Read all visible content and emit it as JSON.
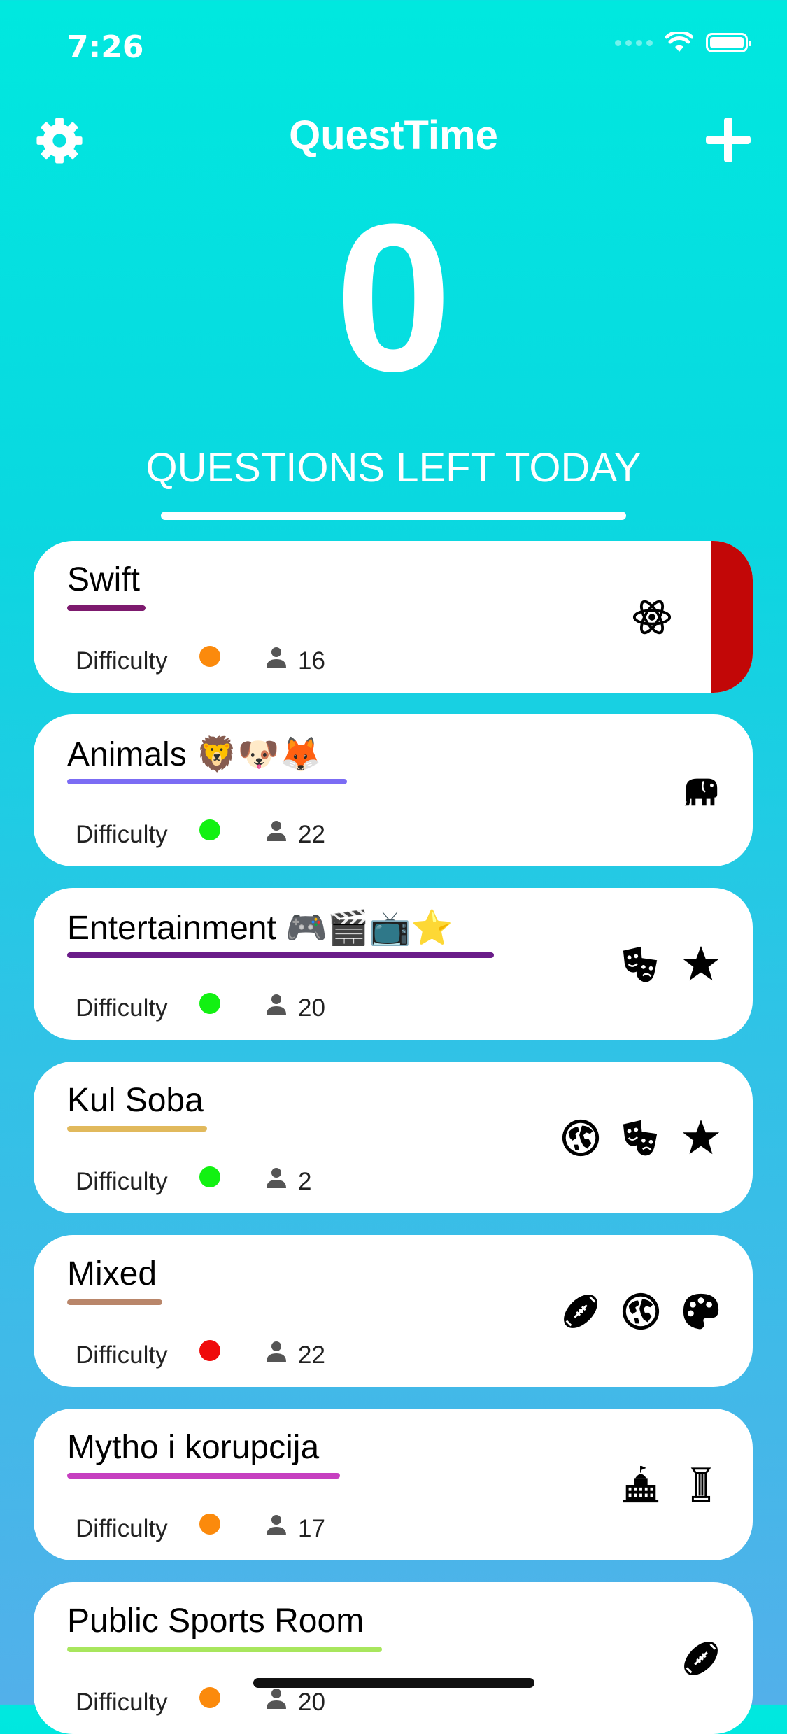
{
  "status_bar": {
    "time": "7:26"
  },
  "header": {
    "title": "QuestTime",
    "settings_icon": "gear-icon",
    "add_icon": "plus-icon"
  },
  "hero": {
    "count": "0",
    "label": "QUESTIONS LEFT TODAY"
  },
  "colors": {
    "background_top": "#00e8df",
    "background_bottom": "#52b0ea",
    "easy": "#12f112",
    "medium": "#fb8a0c",
    "hard": "#ef0b0b",
    "selected_tab": "#c20707"
  },
  "rooms": [
    {
      "name": "Swift",
      "difficulty_label": "Difficulty",
      "difficulty": "medium",
      "players": "16",
      "underline_color": "#7d1a6e",
      "icons": [
        "atom-icon"
      ],
      "selected": true
    },
    {
      "name": "Animals 🦁🐶🦊",
      "difficulty_label": "Difficulty",
      "difficulty": "easy",
      "players": "22",
      "underline_color": "#7b6cf4",
      "icons": [
        "elephant-icon"
      ]
    },
    {
      "name": "Entertainment 🎮🎬📺⭐️",
      "difficulty_label": "Difficulty",
      "difficulty": "easy",
      "players": "20",
      "underline_color": "#6a1d89",
      "icons": [
        "theater-masks-icon",
        "star-icon"
      ]
    },
    {
      "name": "Kul Soba",
      "difficulty_label": "Difficulty",
      "difficulty": "easy",
      "players": "2",
      "underline_color": "#e1b95c",
      "icons": [
        "globe-icon",
        "theater-masks-icon",
        "star-icon"
      ]
    },
    {
      "name": "Mixed",
      "difficulty_label": "Difficulty",
      "difficulty": "hard",
      "players": "22",
      "underline_color": "#b9866a",
      "icons": [
        "football-icon",
        "globe-icon",
        "palette-icon"
      ]
    },
    {
      "name": "Mytho i korupcija",
      "difficulty_label": "Difficulty",
      "difficulty": "medium",
      "players": "17",
      "underline_color": "#c63fc0",
      "icons": [
        "government-building-icon",
        "column-icon"
      ]
    },
    {
      "name": "Public Sports Room",
      "difficulty_label": "Difficulty",
      "difficulty": "medium",
      "players": "20",
      "underline_color": "#a8e65d",
      "icons": [
        "football-icon"
      ]
    }
  ]
}
